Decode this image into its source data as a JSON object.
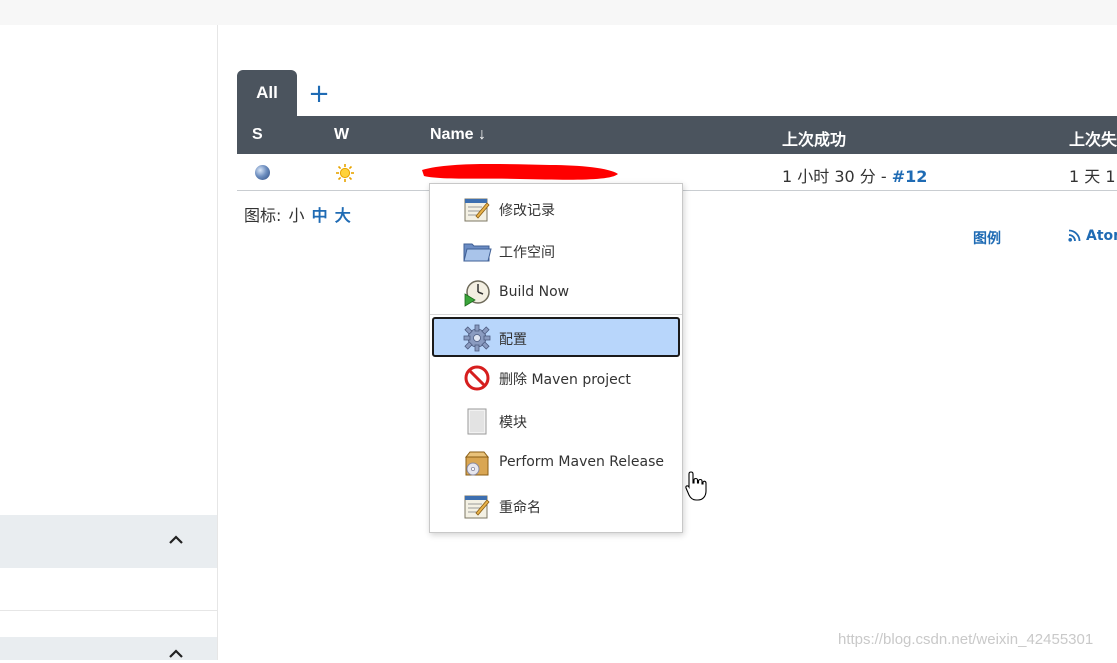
{
  "view_tabs": {
    "active_label": "All",
    "add_label": "+"
  },
  "table": {
    "headers": {
      "s": "S",
      "w": "W",
      "name": "Name  ↓",
      "last_success": "上次成功",
      "last_failure": "上次失"
    },
    "row": {
      "last_success_text": "1 小时 30 分 - ",
      "last_success_build": "#12",
      "last_failure_text": "1 天 1"
    }
  },
  "icon_size": {
    "label": "图标: ",
    "small": "小",
    "medium": "中",
    "large": "大"
  },
  "legend_link": "图例",
  "atom_link": "Atom",
  "context_menu": {
    "items": [
      {
        "label": "修改记录",
        "icon": "notepad-icon"
      },
      {
        "label": "工作空间",
        "icon": "folder-icon"
      },
      {
        "label": "Build Now",
        "icon": "clock-play-icon"
      },
      {
        "label": "配置",
        "icon": "gear-icon",
        "selected": true
      },
      {
        "label": "删除 Maven project",
        "icon": "no-entry-icon"
      },
      {
        "label": "模块",
        "icon": "document-icon"
      },
      {
        "label": "Perform Maven Release",
        "icon": "package-cd-icon"
      },
      {
        "label": "重命名",
        "icon": "notepad-icon"
      }
    ]
  },
  "watermark": "https://blog.csdn.net/weixin_42455301",
  "colors": {
    "header_bg": "#4b545e",
    "link": "#1f6bb4",
    "selection_bg": "#b8d6fb",
    "redaction": "#ff0000"
  }
}
